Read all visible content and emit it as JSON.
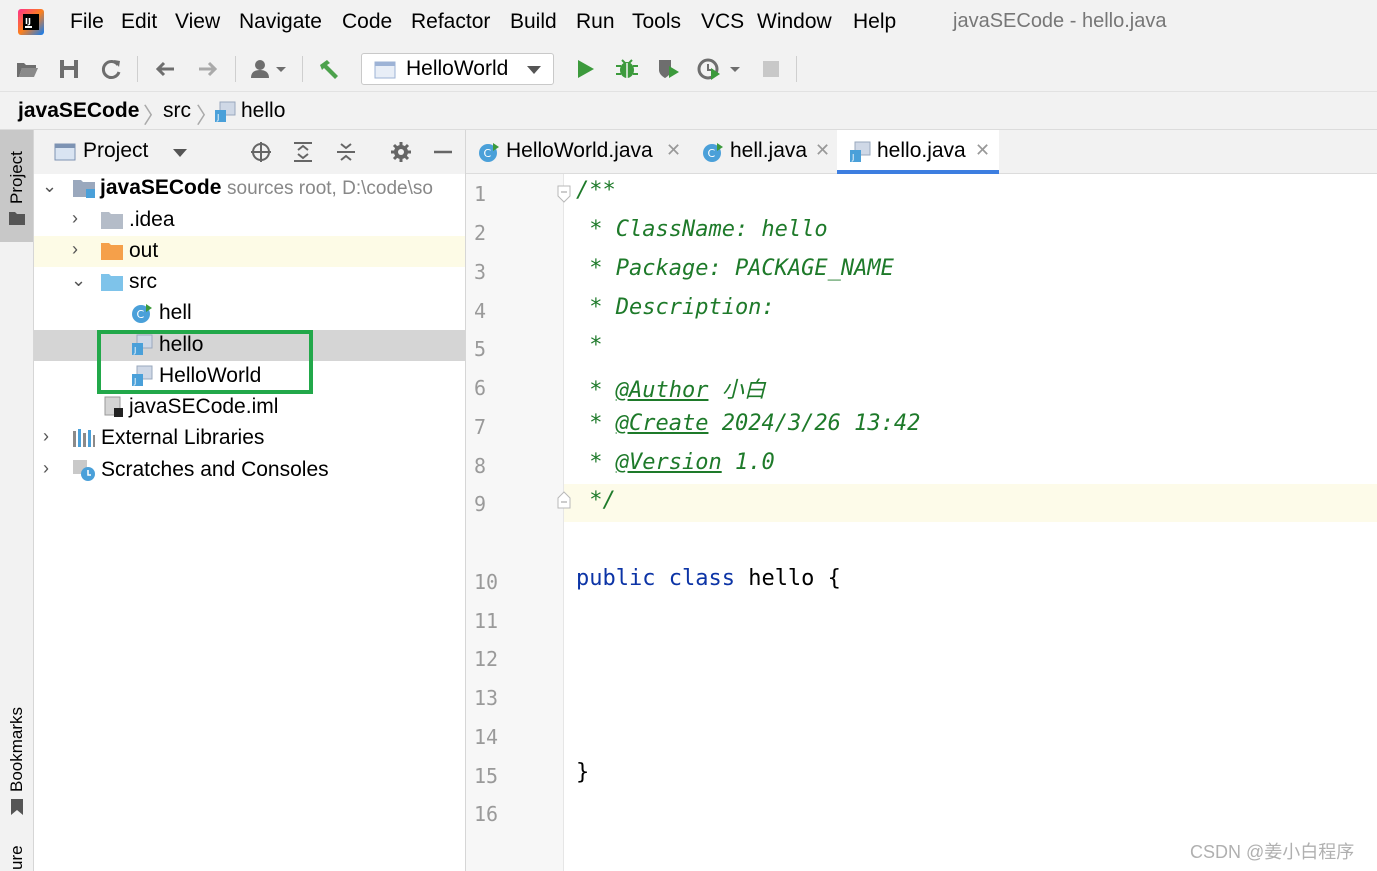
{
  "menubar": {
    "items": [
      "File",
      "Edit",
      "View",
      "Navigate",
      "Code",
      "Refactor",
      "Build",
      "Run",
      "Tools",
      "VCS",
      "Window",
      "Help"
    ],
    "window_title": "javaSECode - hello.java"
  },
  "toolbar": {
    "run_config": "HelloWorld"
  },
  "breadcrumb": {
    "items": [
      "javaSECode",
      "src",
      "hello"
    ]
  },
  "left_strip": {
    "project": "Project",
    "bookmarks": "Bookmarks",
    "structure": "ure"
  },
  "project_panel": {
    "title": "Project",
    "tree": [
      {
        "label": "javaSECode",
        "hint": "sources root,  D:\\code\\so"
      },
      {
        "label": ".idea"
      },
      {
        "label": "out"
      },
      {
        "label": "src"
      },
      {
        "label": "hell"
      },
      {
        "label": "hello"
      },
      {
        "label": "HelloWorld"
      },
      {
        "label": "javaSECode.iml"
      },
      {
        "label": "External Libraries"
      },
      {
        "label": "Scratches and Consoles"
      }
    ]
  },
  "editor": {
    "tabs": [
      {
        "label": "HelloWorld.java"
      },
      {
        "label": "hell.java"
      },
      {
        "label": "hello.java"
      }
    ],
    "line_numbers": [
      "1",
      "2",
      "3",
      "4",
      "5",
      "6",
      "7",
      "8",
      "9",
      "10",
      "11",
      "12",
      "13",
      "14",
      "15",
      "16"
    ],
    "code": {
      "l1": "/**",
      "l2": " * ClassName: hello",
      "l3": " * Package: PACKAGE_NAME",
      "l4": " * Description:",
      "l5": " *",
      "l6_star": " * ",
      "l6_tag": "@Author",
      "l6_val": " 小白",
      "l7_star": " * ",
      "l7_tag": "@Create",
      "l7_val": " 2024/3/26 13:42",
      "l8_star": " * ",
      "l8_tag": "@Version",
      "l8_val": " 1.0",
      "l9": " */",
      "l10_kw": "public class",
      "l10_rest": " hello {",
      "l15": "}"
    }
  },
  "watermark": "CSDN @姜小白程序",
  "colors": {
    "comment": "#1e7a2a",
    "keyword": "#0c34a6",
    "highlight_box": "#22a84a",
    "active_tab_underline": "#3d7ee0"
  }
}
